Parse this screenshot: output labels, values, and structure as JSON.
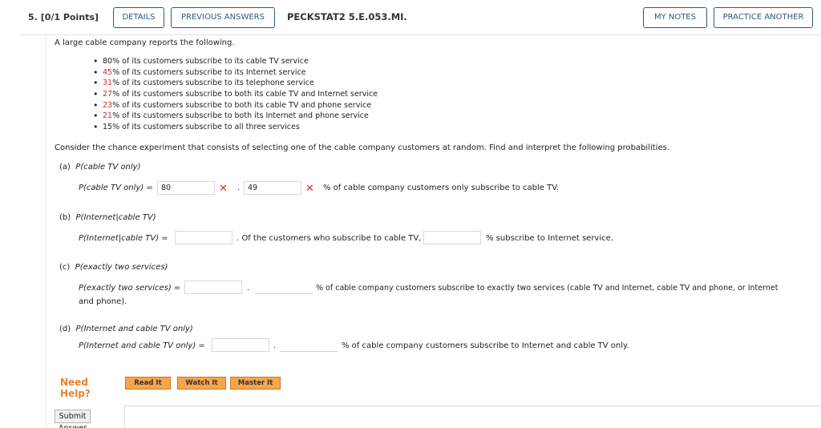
{
  "header": {
    "question_number": "5.",
    "points": "[0/1 Points]",
    "details_label": "DETAILS",
    "previous_answers_label": "PREVIOUS ANSWERS",
    "question_code": "PECKSTAT2 5.E.053.MI.",
    "my_notes_label": "MY NOTES",
    "practice_another_label": "PRACTICE ANOTHER"
  },
  "intro": "A large cable company reports the following.",
  "bullets": [
    {
      "pct": "80",
      "rest": "% of its customers subscribe to its cable TV service",
      "highlight": false
    },
    {
      "pct": "45",
      "rest": "% of its customers subscribe to its Internet service",
      "highlight": true
    },
    {
      "pct": "31",
      "rest": "% of its customers subscribe to its telephone service",
      "highlight": true
    },
    {
      "pct": "27",
      "rest": "% of its customers subscribe to both its cable TV and Internet service",
      "highlight": true
    },
    {
      "pct": "23",
      "rest": "% of its customers subscribe to both its cable TV and phone service",
      "highlight": true
    },
    {
      "pct": "21",
      "rest": "% of its customers subscribe to both its Internet and phone service",
      "highlight": true
    },
    {
      "pct": "15",
      "rest": "% of its customers subscribe to all three services",
      "highlight": false
    }
  ],
  "prompt": "Consider the chance experiment that consists of selecting one of the cable company customers at random. Find and interpret the following probabilities.",
  "parts": {
    "a": {
      "tag": "(a)",
      "title": "P(cable TV only)",
      "lhs": "P(cable TV only) =",
      "input1_value": "80",
      "sep": ".",
      "input2_value": "49",
      "suffix": "% of cable company customers only subscribe to cable TV."
    },
    "b": {
      "tag": "(b)",
      "title": "P(Internet|cable TV)",
      "lhs": "P(Internet|cable TV) =",
      "input1_value": "",
      "mid": ". Of the customers who subscribe to cable TV,",
      "input2_value": "",
      "suffix": "% subscribe to Internet service."
    },
    "c": {
      "tag": "(c)",
      "title": "P(exactly two services)",
      "lhs": "P(exactly two services) =",
      "input1_value": "",
      "sep": ".",
      "input2_value": "",
      "suffix": "% of cable company customers subscribe to exactly two services (cable TV and Internet, cable TV and phone, or Internet",
      "suffix_line2": "and phone)."
    },
    "d": {
      "tag": "(d)",
      "title": "P(Internet and cable TV only)",
      "lhs": "P(Internet and cable TV only) =",
      "input1_value": "",
      "sep": ".",
      "input2_value": "",
      "suffix": "% of cable company customers subscribe to Internet and cable TV only."
    }
  },
  "help": {
    "label": "Need Help?",
    "read_it": "Read It",
    "watch_it": "Watch It",
    "master_it": "Master It"
  },
  "submit_label": "Submit Answer",
  "colors": {
    "accent_blue": "#2c5a85",
    "highlight_red": "#c8302b",
    "error_red": "#d9302c",
    "help_orange": "#e8832a",
    "help_button": "#f6a54a"
  },
  "icons": {
    "incorrect": "x-mark-icon"
  }
}
